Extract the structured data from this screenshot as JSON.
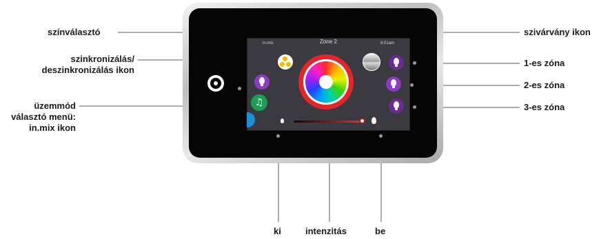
{
  "labels": {
    "color_picker": "színválasztó",
    "sync_line1": "szinkronizálás/",
    "sync_line2": "deszinkronizálás ikon",
    "mode_line1": "üzemmód",
    "mode_line2": "választó menü:",
    "mode_line3": "in.mix ikon",
    "rainbow": "szivárvány ikon",
    "zone1": "1-es zóna",
    "zone2": "2-es zóna",
    "zone3": "3-es zóna",
    "off": "ki",
    "intensity": "intenzitás",
    "on": "be"
  },
  "screen": {
    "brand": "in.mix",
    "zone_title": "Zone 2",
    "time": "8:01am"
  },
  "colors": {
    "ring": "#e3262b",
    "zone_button": "#6a2c8f",
    "mode_light": "#8a3cc4",
    "mode_music": "#1b9f55",
    "mode_wave": "#1c8fd2",
    "sync_dots": "#f3b800"
  },
  "icons": {
    "power": "power-icon",
    "sync": "sync-icon",
    "rainbow": "rainbow-icon",
    "zone": "light-bulb-icon",
    "music": "music-note-icon"
  },
  "intensity_level": 1.0
}
